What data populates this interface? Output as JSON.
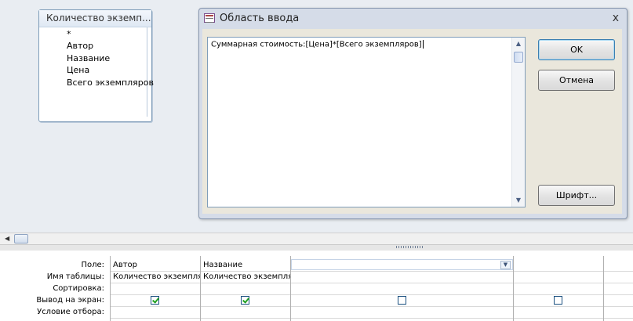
{
  "table_box": {
    "title": "Количество экземп...",
    "fields": [
      "*",
      "Автор",
      "Название",
      "Цена",
      "Всего экземпляров"
    ]
  },
  "dialog": {
    "title": "Область ввода",
    "close_glyph": "x",
    "expression": "Суммарная стоимость:[Цена]*[Всего экземпляров]",
    "ok_label": "OK",
    "cancel_label": "Отмена",
    "font_label": "Шрифт..."
  },
  "qbe_grid": {
    "row_labels": {
      "field": "Поле:",
      "table": "Имя таблицы:",
      "sort": "Сортировка:",
      "show": "Вывод на экран:",
      "criteria": "Условие отбора:"
    },
    "columns": [
      {
        "field": "Автор",
        "table": "Количество экземпляров",
        "show": true
      },
      {
        "field": "Название",
        "table": "Количество экземпляров",
        "show": true
      },
      {
        "field": "",
        "table": "",
        "show": false
      },
      {
        "field": "",
        "table": "",
        "show": false
      }
    ]
  },
  "colors": {
    "upper_bg": "#e9edf2",
    "dialog_bg": "#eae7dc",
    "check_green": "#21a121"
  }
}
